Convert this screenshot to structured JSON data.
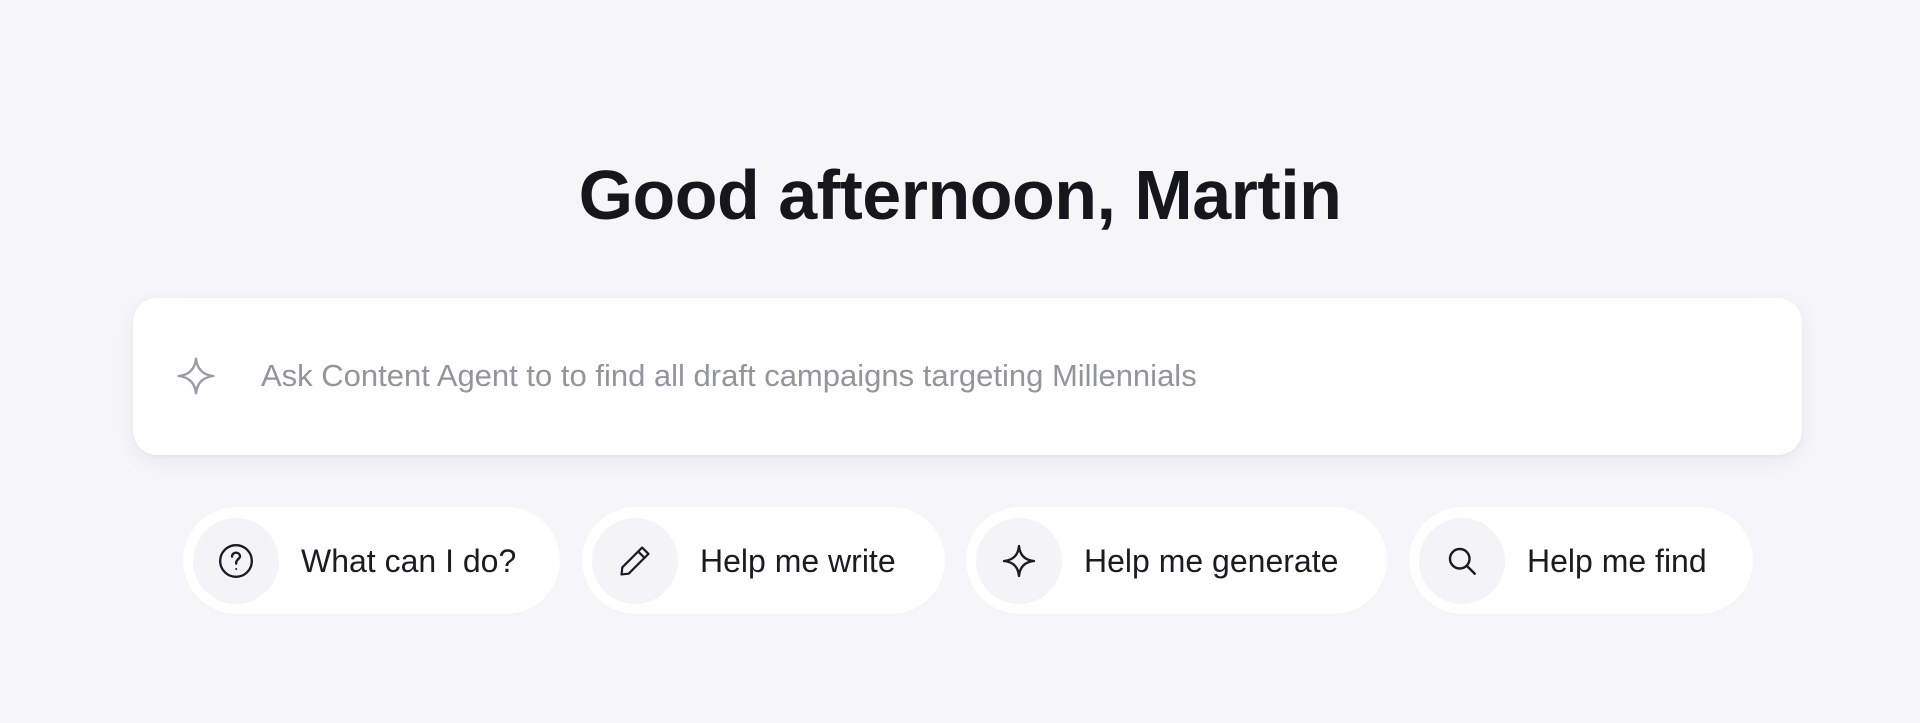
{
  "greeting": "Good afternoon, Martin",
  "prompt": {
    "placeholder": "Ask Content Agent to to find all draft campaigns targeting Millennials",
    "icon": "sparkle-icon"
  },
  "suggestions": [
    {
      "label": "What can I do?",
      "icon": "question-circle-icon"
    },
    {
      "label": "Help me write",
      "icon": "pencil-icon"
    },
    {
      "label": "Help me generate",
      "icon": "sparkle-icon"
    },
    {
      "label": "Help me find",
      "icon": "search-icon"
    }
  ],
  "colors": {
    "background": "#f6f6f8",
    "card": "#ffffff",
    "text": "#15171c",
    "placeholder": "#93959c",
    "icon_muted": "#9a9caa",
    "chip_icon_bg": "#f4f4f6"
  }
}
